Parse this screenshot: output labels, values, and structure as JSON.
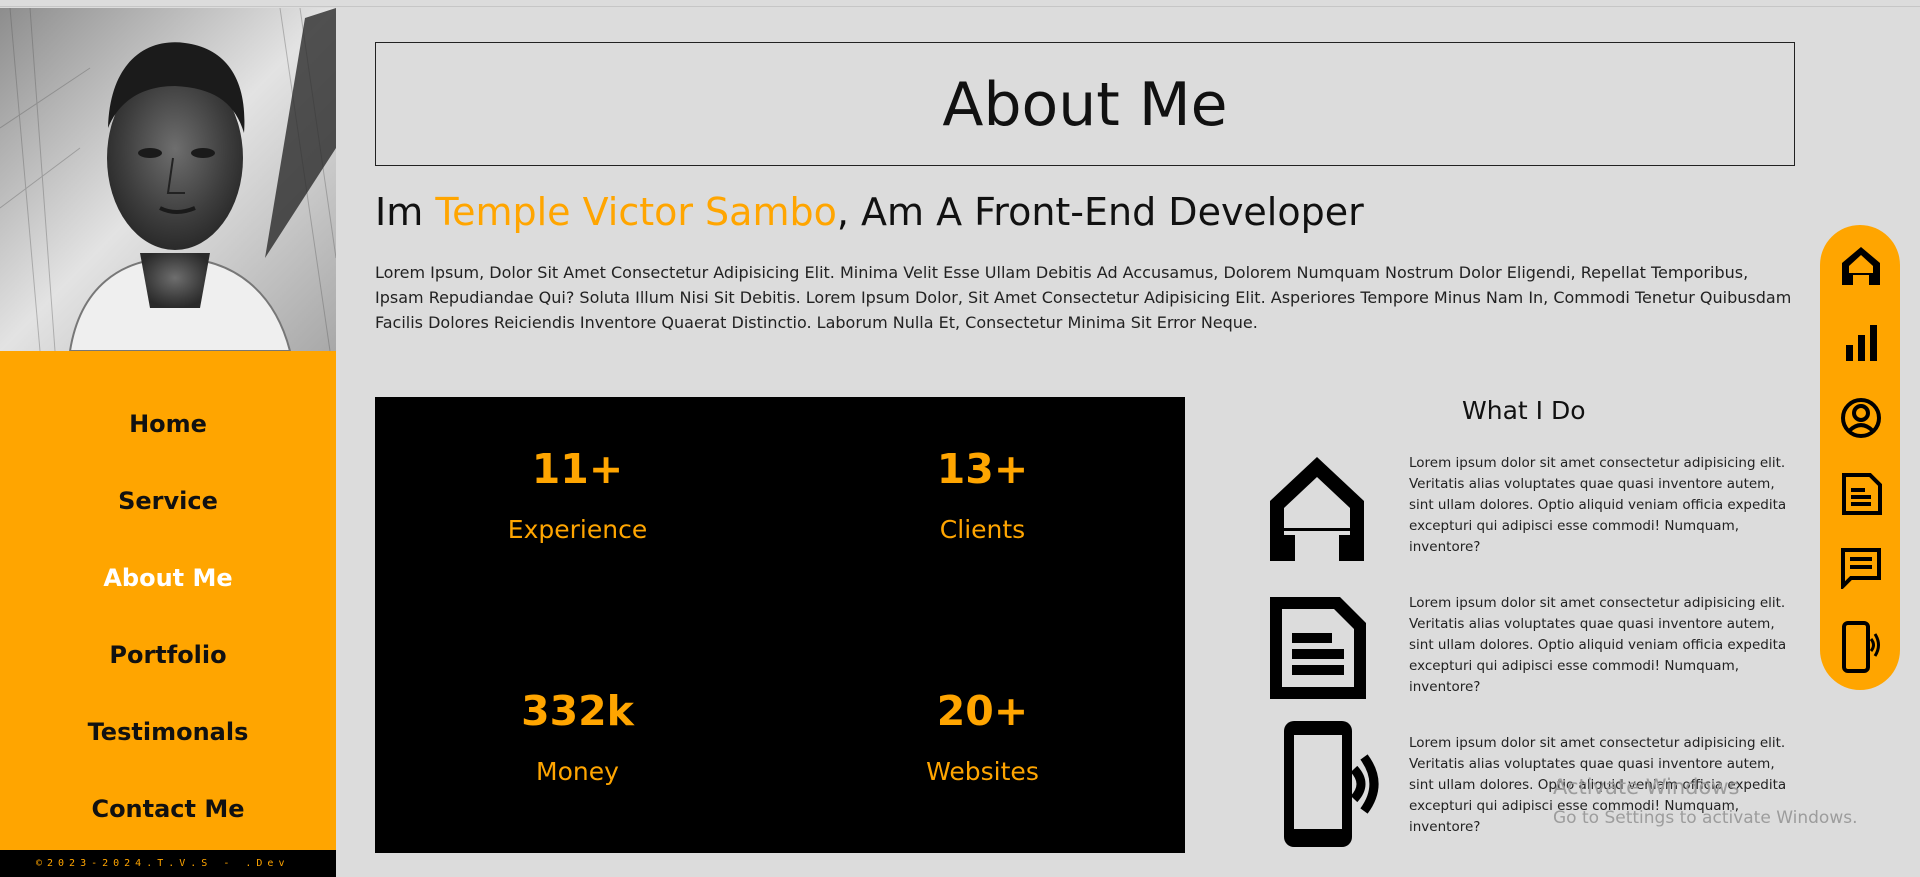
{
  "sidebar": {
    "nav": [
      {
        "label": "Home"
      },
      {
        "label": "Service"
      },
      {
        "label": "About Me"
      },
      {
        "label": "Portfolio"
      },
      {
        "label": "Testimonals"
      },
      {
        "label": "Contact Me"
      }
    ],
    "active_index": 2,
    "footer": "©2023-2024.T.V.S - .Dev"
  },
  "main": {
    "title": "About Me",
    "intro_prefix": "Im ",
    "intro_name": "Temple Victor Sambo",
    "intro_suffix": ", Am A Front-End Developer",
    "paragraph": "Lorem Ipsum, Dolor Sit Amet Consectetur Adipisicing Elit. Minima Velit Esse Ullam Debitis Ad Accusamus, Dolorem Numquam Nostrum Dolor Eligendi, Repellat Temporibus, Ipsam Repudiandae Qui? Soluta Illum Nisi Sit Debitis. Lorem Ipsum Dolor, Sit Amet Consectetur Adipisicing Elit. Asperiores Tempore Minus Nam In, Commodi Tenetur Quibusdam Facilis Dolores Reiciendis Inventore Quaerat Distinctio. Laborum Nulla Et, Consectetur Minima Sit Error Neque.",
    "stats": [
      {
        "number": "11+",
        "label": "Experience"
      },
      {
        "number": "13+",
        "label": "Clients"
      },
      {
        "number": "332k",
        "label": "Money"
      },
      {
        "number": "20+",
        "label": "Websites"
      }
    ],
    "what_i_do": {
      "heading": "What I Do",
      "services": [
        {
          "icon": "home-icon",
          "text": "Lorem ipsum dolor sit amet consectetur adipisicing elit. Veritatis alias voluptates quae quasi inventore autem, sint ullam dolores. Optio aliquid veniam officia expedita excepturi qui adipisci esse commodi! Numquam, inventore?"
        },
        {
          "icon": "document-icon",
          "text": "Lorem ipsum dolor sit amet consectetur adipisicing elit. Veritatis alias voluptates quae quasi inventore autem, sint ullam dolores. Optio aliquid veniam officia expedita excepturi qui adipisci esse commodi! Numquam, inventore?"
        },
        {
          "icon": "phone-icon",
          "text": "Lorem ipsum dolor sit amet consectetur adipisicing elit. Veritatis alias voluptates quae quasi inventore autem, sint ullam dolores. Optio aliquid veniam officia expedita excepturi qui adipisci esse commodi! Numquam, inventore?"
        }
      ]
    }
  },
  "rail": {
    "icons": [
      "home-icon",
      "chart-icon",
      "user-icon",
      "document-icon",
      "message-icon",
      "phone-icon"
    ]
  },
  "watermark": {
    "line1": "Activate Windows",
    "line2": "Go to Settings to activate Windows."
  },
  "colors": {
    "accent": "#ffa500",
    "background": "#dcdcdc",
    "stats_background": "#000000"
  }
}
